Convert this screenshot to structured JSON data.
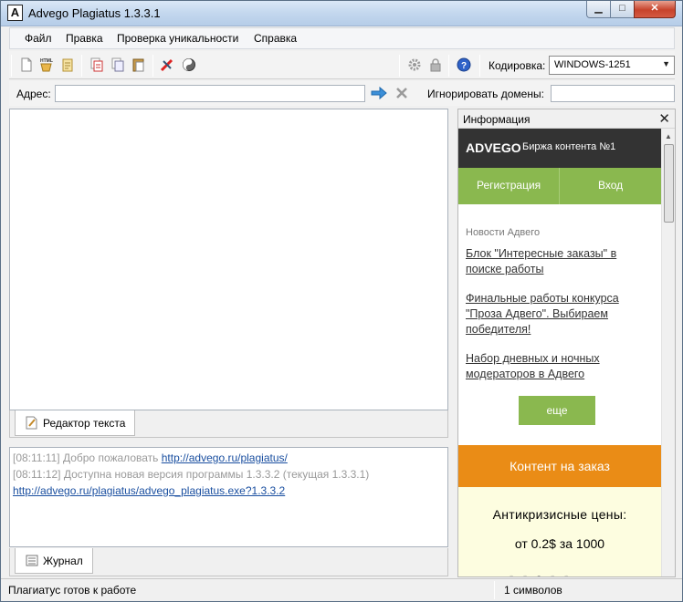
{
  "window": {
    "title": "Advego Plagiatus 1.3.3.1",
    "icon_letter": "A"
  },
  "menu": {
    "items": [
      "Файл",
      "Правка",
      "Проверка уникальности",
      "Справка"
    ]
  },
  "toolbar": {
    "icons": [
      "new-document-icon",
      "html-icon",
      "open-file-icon",
      "copy-icon",
      "copy-doc-icon",
      "paste-icon",
      "check-uniqueness-icon",
      "settings-cycle-icon",
      "gear-icon",
      "lock-icon",
      "help-icon"
    ],
    "encoding_label": "Кодировка:",
    "encoding_value": "WINDOWS-1251"
  },
  "address": {
    "label": "Адрес:",
    "value": "",
    "ignore_label": "Игнорировать домены:",
    "ignore_value": ""
  },
  "editor": {
    "tab_label": "Редактор текста"
  },
  "log": {
    "lines": [
      {
        "time": "[08:11:11]",
        "text": "Добро пожаловать",
        "link": "http://advego.ru/plagiatus/"
      },
      {
        "time": "[08:11:12]",
        "text": "Доступна новая версия программы 1.3.3.2 (текущая 1.3.3.1)",
        "link": ""
      },
      {
        "time": "",
        "text": "",
        "link": "http://advego.ru/plagiatus/advego_plagiatus.exe?1.3.3.2"
      }
    ],
    "tab_label": "Журнал"
  },
  "info": {
    "title": "Информация",
    "close": "✕",
    "logo": "ADVEGO",
    "tagline": "Биржа контента №1",
    "nav": [
      "Регистрация",
      "Вход"
    ],
    "news_label": "Новости Адвего",
    "news": [
      "Блок \"Интересные заказы\" в поиске работы",
      "Финальные работы конкурса \"Проза Адвего\". Выбираем победителя!",
      "Набор дневных и ночных модераторов в Адвего"
    ],
    "more_button": "еще",
    "order_banner": "Контент на заказ",
    "promo_line1": "Антикризисные цены:",
    "promo_line2": "от 0.2$ за 1000"
  },
  "status": {
    "left": "Плагиатус готов к работе",
    "right": "1 символов"
  },
  "colors": {
    "accent_green": "#8ab84f",
    "accent_orange": "#ea8c16",
    "header_dark": "#333333",
    "link_blue": "#1a4fa0"
  }
}
